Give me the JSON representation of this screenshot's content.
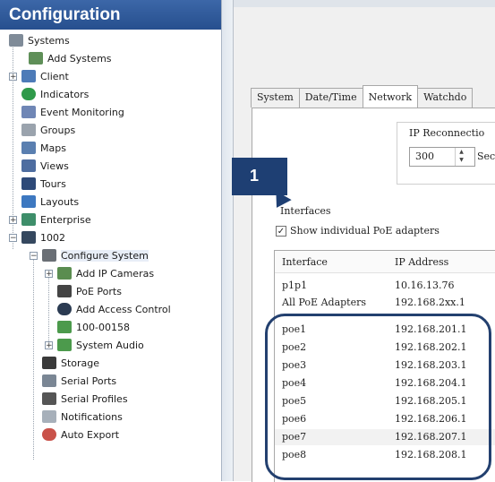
{
  "left_panel": {
    "title": "Configuration",
    "tree": [
      {
        "label": "Systems",
        "icon": "systems-icon"
      },
      {
        "label": "Add Systems",
        "icon": "add-systems-icon"
      },
      {
        "label": "Client",
        "icon": "client-icon"
      },
      {
        "label": "Indicators",
        "icon": "indicators-icon"
      },
      {
        "label": "Event Monitoring",
        "icon": "event-monitoring-icon"
      },
      {
        "label": "Groups",
        "icon": "groups-icon"
      },
      {
        "label": "Maps",
        "icon": "maps-icon"
      },
      {
        "label": "Views",
        "icon": "views-icon"
      },
      {
        "label": "Tours",
        "icon": "tours-icon"
      },
      {
        "label": "Layouts",
        "icon": "layouts-icon"
      },
      {
        "label": "Enterprise",
        "icon": "enterprise-icon"
      },
      {
        "label": "1002",
        "icon": "system-1002-icon"
      },
      {
        "label": "Configure System",
        "icon": "configure-system-icon"
      },
      {
        "label": "Add IP Cameras",
        "icon": "add-ip-cameras-icon"
      },
      {
        "label": "PoE Ports",
        "icon": "poe-ports-icon"
      },
      {
        "label": "Add Access Control",
        "icon": "add-access-control-icon"
      },
      {
        "label": "100-00158",
        "icon": "access-control-device-icon"
      },
      {
        "label": "System Audio",
        "icon": "system-audio-icon"
      },
      {
        "label": "Storage",
        "icon": "storage-icon"
      },
      {
        "label": "Serial Ports",
        "icon": "serial-ports-icon"
      },
      {
        "label": "Serial Profiles",
        "icon": "serial-profiles-icon"
      },
      {
        "label": "Notifications",
        "icon": "notifications-icon"
      },
      {
        "label": "Auto Export",
        "icon": "auto-export-icon"
      }
    ]
  },
  "tabs": [
    "System",
    "Date/Time",
    "Network",
    "Watchdo"
  ],
  "active_tab": "Network",
  "ip_reconnection": {
    "label": "IP Reconnectio",
    "value": "300",
    "unit": "Sec"
  },
  "interfaces": {
    "label": "Interfaces",
    "show_poe_label": "Show individual PoE adapters",
    "show_poe_checked": "✓",
    "columns": [
      "Interface",
      "IP Address"
    ],
    "rows": [
      [
        "p1p1",
        "10.16.13.76"
      ],
      [
        "All PoE Adapters",
        "192.168.2xx.1"
      ],
      [
        "poe1",
        "192.168.201.1"
      ],
      [
        "poe2",
        "192.168.202.1"
      ],
      [
        "poe3",
        "192.168.203.1"
      ],
      [
        "poe4",
        "192.168.204.1"
      ],
      [
        "poe5",
        "192.168.205.1"
      ],
      [
        "poe6",
        "192.168.206.1"
      ],
      [
        "poe7",
        "192.168.207.1"
      ],
      [
        "poe8",
        "192.168.208.1"
      ]
    ]
  },
  "callout": {
    "number": "1"
  },
  "colors": {
    "header_blue": "#2f5b9b",
    "callout_navy": "#1e3f73",
    "highlight_border": "#23406f"
  }
}
